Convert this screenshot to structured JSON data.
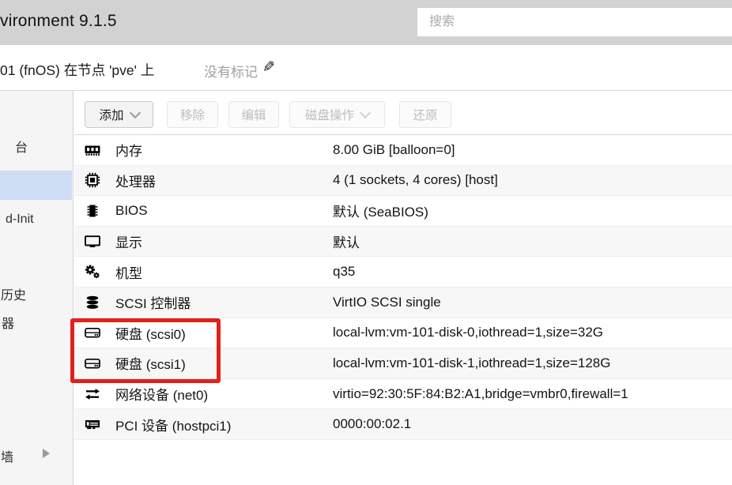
{
  "header": {
    "title": "vironment 9.1.5",
    "search_placeholder": "搜索"
  },
  "breadcrumb": {
    "vm_title": "01 (fnOS) 在节点 'pve' 上",
    "tags_label": "没有标记"
  },
  "sidebar": {
    "items": [
      {
        "label": "台",
        "selected": false
      },
      {
        "label": "",
        "selected": true
      },
      {
        "label": "d-Init",
        "selected": false
      },
      {
        "label": "历史",
        "selected": false
      },
      {
        "label": "器",
        "selected": false
      },
      {
        "label": "墙",
        "selected": false,
        "has_expand_arrow": true
      }
    ]
  },
  "toolbar": {
    "add_label": "添加",
    "remove_label": "移除",
    "edit_label": "编辑",
    "disk_action_label": "磁盘操作",
    "revert_label": "还原"
  },
  "hardware": {
    "rows": [
      {
        "icon": "memory-icon",
        "label": "内存",
        "value": "8.00 GiB [balloon=0]"
      },
      {
        "icon": "cpu-icon",
        "label": "处理器",
        "value": "4 (1 sockets, 4 cores) [host]"
      },
      {
        "icon": "bios-chip-icon",
        "label": "BIOS",
        "value": "默认 (SeaBIOS)"
      },
      {
        "icon": "display-icon",
        "label": "显示",
        "value": "默认"
      },
      {
        "icon": "cogs-icon",
        "label": "机型",
        "value": "q35"
      },
      {
        "icon": "database-icon",
        "label": "SCSI 控制器",
        "value": "VirtIO SCSI single"
      },
      {
        "icon": "hdd-icon",
        "label": "硬盘 (scsi0)",
        "value": "local-lvm:vm-101-disk-0,iothread=1,size=32G"
      },
      {
        "icon": "hdd-icon",
        "label": "硬盘 (scsi1)",
        "value": "local-lvm:vm-101-disk-1,iothread=1,size=128G"
      },
      {
        "icon": "exchange-icon",
        "label": "网络设备 (net0)",
        "value": "virtio=92:30:5F:84:B2:A1,bridge=vmbr0,firewall=1"
      },
      {
        "icon": "pci-card-icon",
        "label": "PCI 设备 (hostpci1)",
        "value": "0000:00:02.1"
      }
    ]
  },
  "annotation": {
    "type": "rectangle",
    "color": "#e32119",
    "highlights": "硬盘 (scsi0) 与 硬盘 (scsi1) 行"
  }
}
